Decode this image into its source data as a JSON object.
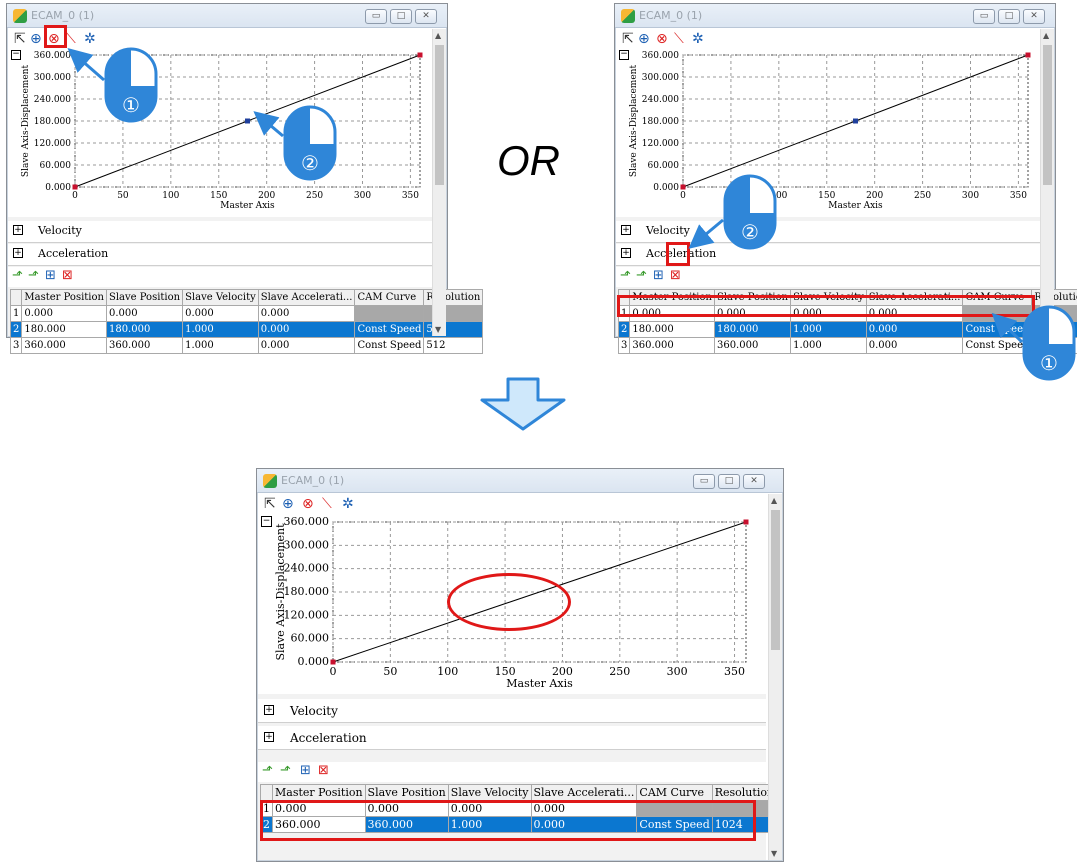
{
  "window_title": "ECAM_0 (1)",
  "window_buttons": {
    "min": "▭",
    "max": "□",
    "close": "✕"
  },
  "or_label": "OR",
  "chart_data": {
    "type": "line",
    "xlabel": "Master Axis",
    "ylabel": "Slave Axis-Displacement",
    "xticks": [
      "0",
      "50",
      "100",
      "150",
      "200",
      "250",
      "300",
      "350"
    ],
    "yticks": [
      "0.000",
      "60.000",
      "120.000",
      "180.000",
      "240.000",
      "300.000",
      "360.000"
    ],
    "xlim": [
      0,
      360
    ],
    "ylim": [
      0,
      360
    ],
    "grid": true,
    "series_before": [
      {
        "x": 0,
        "y": 0
      },
      {
        "x": 180,
        "y": 180
      },
      {
        "x": 360,
        "y": 360
      }
    ],
    "series_after": [
      {
        "x": 0,
        "y": 0
      },
      {
        "x": 360,
        "y": 360
      }
    ]
  },
  "sections": {
    "velocity": "Velocity",
    "acceleration": "Acceleration"
  },
  "table": {
    "columns": [
      "Master Position",
      "Slave Position",
      "Slave Velocity",
      "Slave Accelerati...",
      "CAM Curve",
      "Resolution"
    ],
    "rows_before": [
      [
        "1",
        "0.000",
        "0.000",
        "0.000",
        "0.000",
        "",
        ""
      ],
      [
        "2",
        "180.000",
        "180.000",
        "1.000",
        "0.000",
        "Const Speed",
        "512"
      ],
      [
        "3",
        "360.000",
        "360.000",
        "1.000",
        "0.000",
        "Const Speed",
        "512"
      ]
    ],
    "rows_after": [
      [
        "1",
        "0.000",
        "0.000",
        "0.000",
        "0.000",
        "",
        ""
      ],
      [
        "2",
        "360.000",
        "360.000",
        "1.000",
        "0.000",
        "Const Speed",
        "1024"
      ]
    ]
  },
  "callouts": {
    "one": "①",
    "two": "②"
  },
  "colors": {
    "selection": "#0b77d0",
    "highlight": "#e01818",
    "arrow": "#2f86d8"
  }
}
